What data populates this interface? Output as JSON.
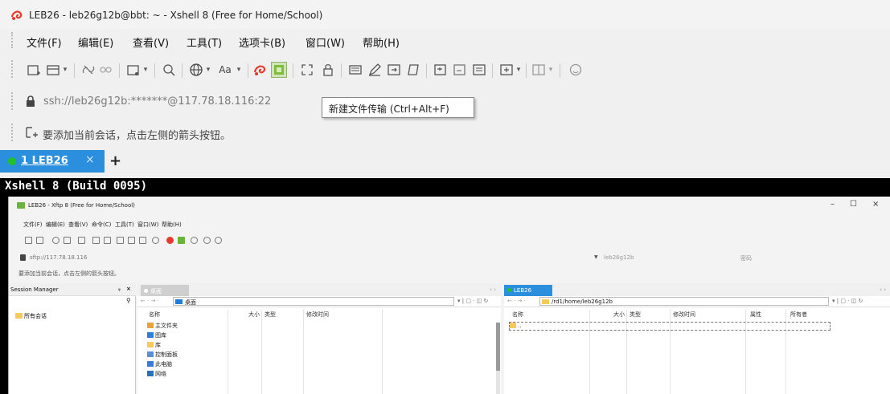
{
  "xshell": {
    "title": "LEB26 - leb26g12b@bbt: ~ - Xshell 8 (Free for Home/School)",
    "menu": [
      "文件(F)",
      "编辑(E)",
      "查看(V)",
      "工具(T)",
      "选项卡(B)",
      "窗口(W)",
      "帮助(H)"
    ],
    "toolbar_icons": [
      "new-session-icon",
      "open-session-icon",
      "dropdown-icon",
      "disconnect-icon",
      "reconnect-icon",
      "new-tab-icon",
      "dropdown-icon",
      "find-icon",
      "globe-icon",
      "dropdown-icon",
      "font-icon",
      "dropdown-icon",
      "xftp-icon",
      "new-file-transfer-icon",
      "fullscreen-icon",
      "lock-icon",
      "keyboard-icon",
      "compose-icon",
      "script-icon",
      "log-icon",
      "send-icon",
      "send-all-icon",
      "notes-icon",
      "layout-icon",
      "dropdown-icon",
      "split-icon",
      "dropdown-icon",
      "help-icon"
    ],
    "address": "ssh://leb26g12b:*******@117.78.18.116:22",
    "tooltip": "新建文件传输 (Ctrl+Alt+F)",
    "session_hint": "要添加当前会话，点击左侧的箭头按钮。",
    "tab": {
      "label": "1 LEB26",
      "close": "×",
      "add": "+"
    },
    "terminal_text": "Xshell 8 (Build 0095)"
  },
  "xftp": {
    "title": "LEB26 - Xftp 8 (Free for Home/School)",
    "menu": [
      "文件(F)",
      "编辑(E)",
      "查看(V)",
      "命令(C)",
      "工具(T)",
      "窗口(W)",
      "帮助(H)"
    ],
    "address": "sftp://117.78.18.116",
    "user": "leb26g12b",
    "password_placeholder": "密码",
    "session_hint": "要添加当前会话，点击左侧的箭头按钮。",
    "window_buttons": [
      "–",
      "☐",
      "×"
    ],
    "session_manager": {
      "title": "Session Manager",
      "pin": "ᵩ",
      "close": "×",
      "item": "所有会话"
    },
    "local": {
      "tab": "桌面",
      "path": "桌面",
      "columns": [
        "名称",
        "大小",
        "类型",
        "修改时间"
      ],
      "rows": [
        {
          "name": "主文件夹",
          "icon_color": "#e9a23b"
        },
        {
          "name": "图库",
          "icon_color": "#2f7fd6"
        },
        {
          "name": "库",
          "icon_color": "#f4c95d"
        },
        {
          "name": "控制面板",
          "icon_color": "#5b8fd0"
        },
        {
          "name": "此电脑",
          "icon_color": "#3a7bd5"
        },
        {
          "name": "网络",
          "icon_color": "#2a6fb8"
        }
      ]
    },
    "remote": {
      "tab": "LEB26",
      "path": "/rd1/home/leb26g12b",
      "columns": [
        "名称",
        "大小",
        "类型",
        "修改时间",
        "属性",
        "所有者"
      ],
      "rows": [
        {
          "name": ".."
        }
      ]
    }
  },
  "colors": {
    "accent": "#2c8fde",
    "terminal_bg": "#000000",
    "status_green": "#22c22a"
  }
}
